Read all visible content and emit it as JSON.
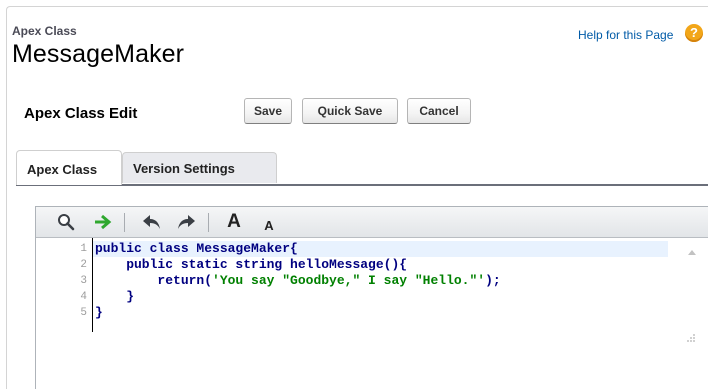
{
  "header": {
    "breadcrumb": "Apex Class",
    "title": "MessageMaker",
    "help_link": "Help for this Page",
    "help_icon": "?"
  },
  "edit": {
    "label": "Apex Class Edit",
    "save": "Save",
    "quick_save": "Quick Save",
    "cancel": "Cancel"
  },
  "tabs": [
    {
      "label": "Apex Class",
      "active": true
    },
    {
      "label": "Version Settings",
      "active": false
    }
  ],
  "toolbar": {
    "icons": [
      "search-icon",
      "go-to-line-icon",
      "undo-icon",
      "redo-icon",
      "font-increase-icon",
      "font-decrease-icon"
    ],
    "font_large": "A",
    "font_small": "A"
  },
  "code": {
    "line_numbers": [
      "1",
      "2",
      "3",
      "4",
      "5"
    ],
    "lines": [
      {
        "pre": "public class MessageMaker{",
        "str": "",
        "post": ""
      },
      {
        "pre": "    public static string helloMessage(){",
        "str": "",
        "post": ""
      },
      {
        "pre": "        return(",
        "str": "'You say \"Goodbye,\" I say \"Hello.\"'",
        "post": ");"
      },
      {
        "pre": "    }",
        "str": "",
        "post": ""
      },
      {
        "pre": "}",
        "str": "",
        "post": ""
      }
    ]
  },
  "colors": {
    "help_link": "#015ba7",
    "help_icon": "#f2a619",
    "keyword": "#000080",
    "string": "#008000",
    "active_line": "#e8f2fe",
    "go_arrow": "#2fa82f"
  }
}
